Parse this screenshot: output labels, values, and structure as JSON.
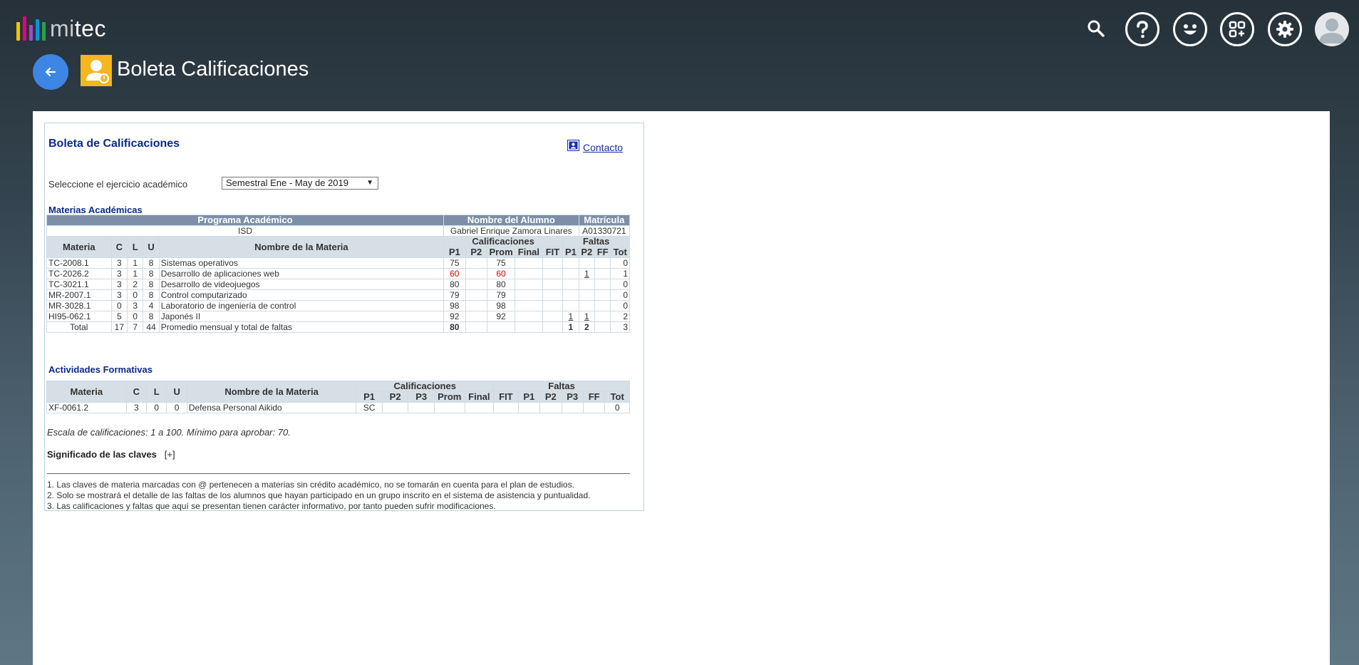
{
  "app": {
    "logo_prefix": "mi",
    "logo_suffix": "tec",
    "logo_bar_colors": [
      "#f2c400",
      "#e5007e",
      "#9b4dca",
      "#0096d6",
      "#2c9e4b"
    ],
    "accent": "#3d86e3"
  },
  "header": {
    "title": "Boleta Calificaciones",
    "icons": [
      "search-icon",
      "help-icon",
      "feedback-smile-icon",
      "apps-grid-icon",
      "settings-icon",
      "user-avatar-icon"
    ]
  },
  "panel": {
    "title": "Boleta de Calificaciones",
    "contact_label": "Contacto",
    "select_label": "Seleccione el ejercicio académico",
    "select_value": "Semestral Ene - May de 2019"
  },
  "academic": {
    "section_title": "Materias Académicas",
    "headers": {
      "programa": "Programa Académico",
      "nombre_alumno": "Nombre del Alumno",
      "matricula": "Matrícula",
      "materia": "Materia",
      "c": "C",
      "l": "L",
      "u": "U",
      "nombre_materia": "Nombre de la Materia",
      "calificaciones": "Calificaciones",
      "faltas": "Faltas",
      "p1": "P1",
      "p2": "P2",
      "prom": "Prom",
      "final": "Final",
      "fit": "FIT",
      "fp1": "P1",
      "fp2": "P2",
      "ff": "FF",
      "tot": "Tot"
    },
    "student": {
      "programa": "ISD",
      "nombre": "Gabriel Enrique Zamora Linares",
      "matricula": "A01330721"
    },
    "rows": [
      {
        "materia": "TC-2008.1",
        "c": "3",
        "l": "1",
        "u": "8",
        "nombre": "Sistemas operativos",
        "p1": "75",
        "p2": "",
        "prom": "75",
        "final": "",
        "fit": "",
        "fp1": "",
        "fp2": "",
        "ff": "",
        "tot": "0"
      },
      {
        "materia": "TC-2026.2",
        "c": "3",
        "l": "1",
        "u": "8",
        "nombre": "Desarrollo de aplicaciones web",
        "p1": "60",
        "p2": "",
        "prom": "60",
        "final": "",
        "fit": "",
        "fp1": "",
        "fp2": "1",
        "ff": "",
        "tot": "1"
      },
      {
        "materia": "TC-3021.1",
        "c": "3",
        "l": "2",
        "u": "8",
        "nombre": "Desarrollo de videojuegos",
        "p1": "80",
        "p2": "",
        "prom": "80",
        "final": "",
        "fit": "",
        "fp1": "",
        "fp2": "",
        "ff": "",
        "tot": "0"
      },
      {
        "materia": "MR-2007.1",
        "c": "3",
        "l": "0",
        "u": "8",
        "nombre": "Control computarizado",
        "p1": "79",
        "p2": "",
        "prom": "79",
        "final": "",
        "fit": "",
        "fp1": "",
        "fp2": "",
        "ff": "",
        "tot": "0"
      },
      {
        "materia": "MR-3028.1",
        "c": "0",
        "l": "3",
        "u": "4",
        "nombre": "Laboratorio de ingeniería de control",
        "p1": "98",
        "p2": "",
        "prom": "98",
        "final": "",
        "fit": "",
        "fp1": "",
        "fp2": "",
        "ff": "",
        "tot": "0"
      },
      {
        "materia": "HI95-062.1",
        "c": "5",
        "l": "0",
        "u": "8",
        "nombre": "Japonés II",
        "p1": "92",
        "p2": "",
        "prom": "92",
        "final": "",
        "fit": "",
        "fp1": "1",
        "fp2": "1",
        "ff": "",
        "tot": "2"
      }
    ],
    "total": {
      "label": "Total",
      "c": "17",
      "l": "7",
      "u": "44",
      "nombre": "Promedio mensual y total de faltas",
      "p1": "80",
      "fp1": "1",
      "fp2": "2",
      "tot": "3"
    },
    "failing_color": "#e00000"
  },
  "formative": {
    "section_title": "Actividades Formativas",
    "headers": {
      "materia": "Materia",
      "c": "C",
      "l": "L",
      "u": "U",
      "nombre_materia": "Nombre de la Materia",
      "calificaciones": "Calificaciones",
      "faltas": "Faltas",
      "p1": "P1",
      "p2": "P2",
      "p3": "P3",
      "prom": "Prom",
      "final": "Final",
      "fit": "FIT",
      "fp1": "P1",
      "fp2": "P2",
      "fp3": "P3",
      "ff": "FF",
      "tot": "Tot"
    },
    "rows": [
      {
        "materia": "XF-0061.2",
        "c": "3",
        "l": "0",
        "u": "0",
        "nombre": "Defensa Personal Aikido",
        "p1": "SC",
        "tot": "0"
      }
    ]
  },
  "scale_text": "Escala de calificaciones: 1 a 100. Mínimo para aprobar: 70.",
  "claves": {
    "label": "Significado de las claves",
    "toggle": "[+]"
  },
  "notes": [
    "1. Las claves de materia marcadas con @ pertenecen a materias sin crédito académico, no se tomarán en cuenta para el plan de estudios.",
    "2. Solo se mostrará el detalle de las faltas de los alumnos que hayan participado en un grupo inscrito en el sistema de asistencia y puntualidad.",
    "3. Las calificaciones y faltas que aquí se presentan tienen carácter informativo, por tanto pueden sufrir modificaciones."
  ]
}
